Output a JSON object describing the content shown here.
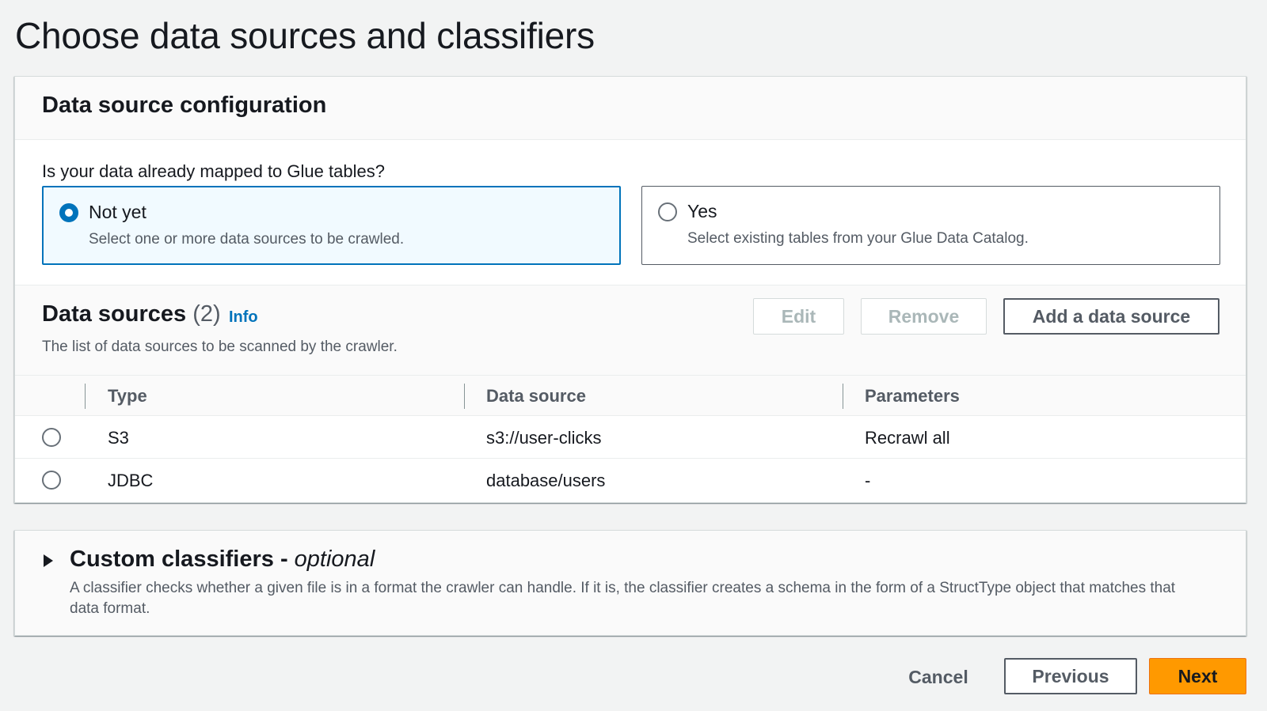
{
  "page": {
    "title": "Choose data sources and classifiers"
  },
  "config": {
    "heading": "Data source configuration",
    "question": "Is your data already mapped to Glue tables?",
    "options": [
      {
        "label": "Not yet",
        "description": "Select one or more data sources to be crawled.",
        "selected": true
      },
      {
        "label": "Yes",
        "description": "Select existing tables from your Glue Data Catalog.",
        "selected": false
      }
    ]
  },
  "sources": {
    "title": "Data sources",
    "count": "(2)",
    "info": "Info",
    "description": "The list of data sources to be scanned by the crawler.",
    "buttons": {
      "edit": "Edit",
      "remove": "Remove",
      "add": "Add a data source"
    },
    "columns": [
      "Type",
      "Data source",
      "Parameters"
    ],
    "rows": [
      {
        "type": "S3",
        "source": "s3://user-clicks",
        "params": "Recrawl all"
      },
      {
        "type": "JDBC",
        "source": "database/users",
        "params": "-"
      }
    ]
  },
  "classifiers": {
    "title": "Custom classifiers -",
    "optional": "optional",
    "description": "A classifier checks whether a given file is in a format the crawler can handle. If it is, the classifier creates a schema in the form of a StructType object that matches that data format."
  },
  "footer": {
    "cancel": "Cancel",
    "previous": "Previous",
    "next": "Next"
  },
  "colors": {
    "accent": "#0073bb",
    "primary": "#ff9900"
  }
}
